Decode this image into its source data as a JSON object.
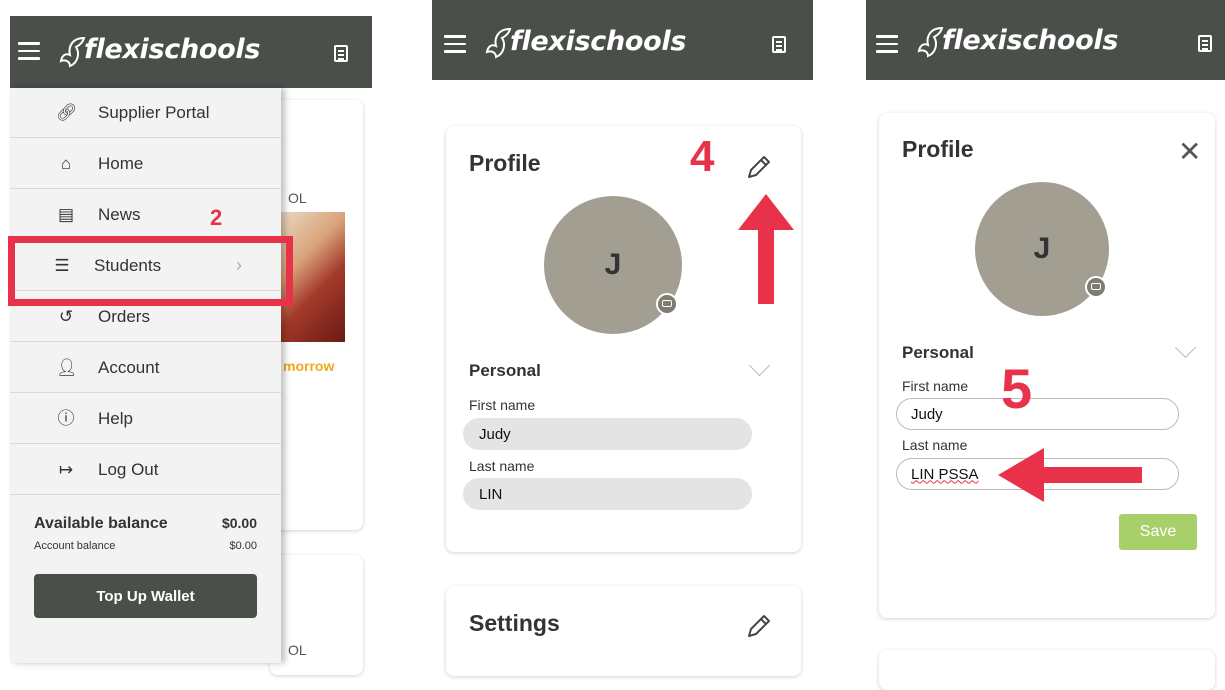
{
  "brand": {
    "name": "flexischools"
  },
  "panel1": {
    "menu_items": [
      {
        "label": "Supplier Portal",
        "icon": "link-icon"
      },
      {
        "label": "Home",
        "icon": "home-icon"
      },
      {
        "label": "News",
        "icon": "news-icon"
      },
      {
        "label": "Students",
        "icon": "students-icon"
      },
      {
        "label": "Orders",
        "icon": "orders-history-icon"
      },
      {
        "label": "Account",
        "icon": "account-icon"
      },
      {
        "label": "Help",
        "icon": "help-icon"
      },
      {
        "label": "Log Out",
        "icon": "logout-icon"
      }
    ],
    "balance": {
      "available_label": "Available balance",
      "available_value": "$0.00",
      "account_label": "Account balance",
      "account_value": "$0.00"
    },
    "topup_label": "Top Up Wallet",
    "annotation_step": "2",
    "background_text": {
      "school_1": "OL",
      "tomorrow": "morrow",
      "school_2": "OL"
    }
  },
  "panel2": {
    "profile_title": "Profile",
    "avatar_initial": "J",
    "personal_label": "Personal",
    "first_name_label": "First name",
    "first_name_value": "Judy",
    "last_name_label": "Last name",
    "last_name_value": "LIN",
    "settings_title": "Settings",
    "annotation_step": "4"
  },
  "panel3": {
    "profile_title": "Profile",
    "avatar_initial": "J",
    "personal_label": "Personal",
    "first_name_label": "First name",
    "first_name_value": "Judy",
    "last_name_label": "Last name",
    "last_name_value": "LIN PSSA",
    "save_label": "Save",
    "annotation_step": "5"
  },
  "colors": {
    "header": "#4a4f4a",
    "annotation_red": "#e8324a",
    "save_green": "#a8d06a",
    "avatar": "#a29e92"
  }
}
